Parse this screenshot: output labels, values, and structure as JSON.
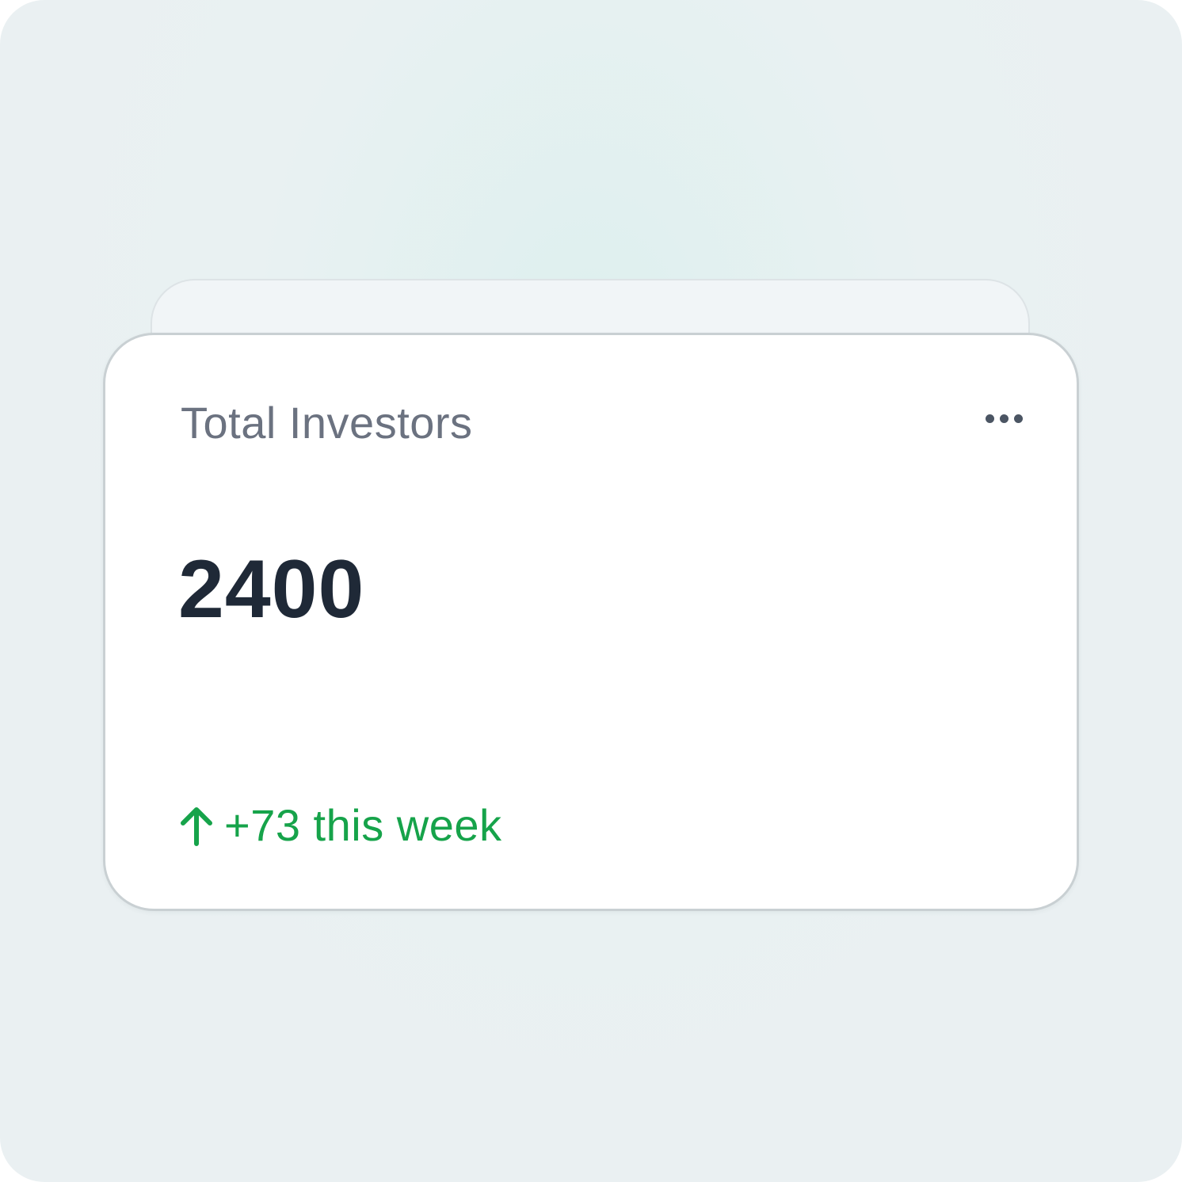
{
  "widget": {
    "title": "Total Investors",
    "value": "2400",
    "trend": {
      "direction": "up",
      "text": "+73 this week",
      "color": "#16a34a",
      "icon": "arrow-up-icon"
    },
    "menu_icon": "more-horizontal-icon"
  },
  "colors": {
    "title": "#6b7280",
    "value": "#1f2937",
    "trend": "#16a34a"
  }
}
